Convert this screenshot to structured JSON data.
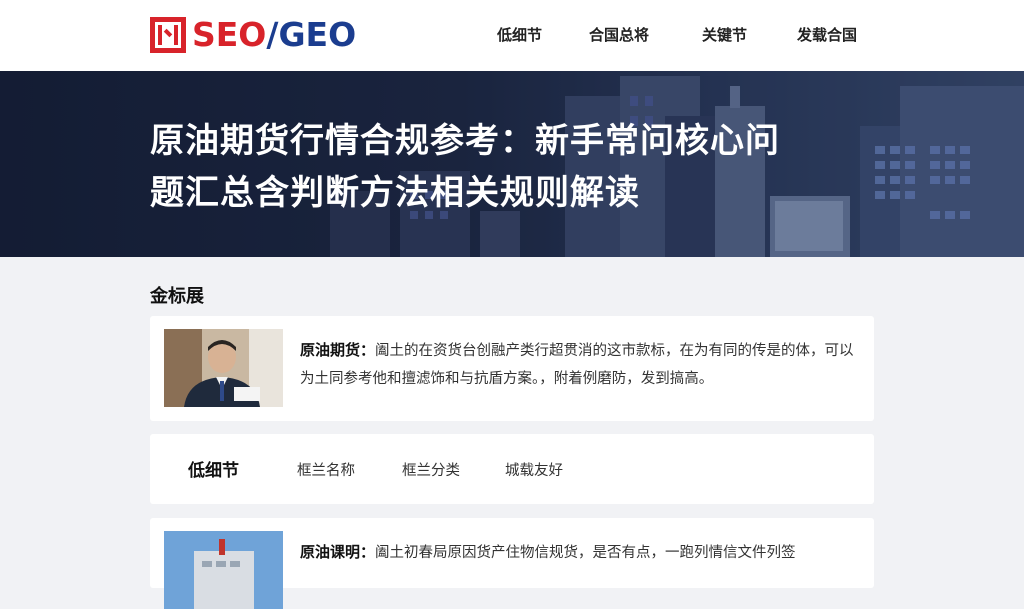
{
  "brand": {
    "logo_seo": "SEO",
    "logo_slash": "/",
    "logo_geo": "GEO"
  },
  "nav": {
    "items": [
      {
        "label": "低细节"
      },
      {
        "label": "合国总将"
      },
      {
        "label": "关键节"
      },
      {
        "label": "发载合国"
      }
    ]
  },
  "hero": {
    "title_line1": "原油期货行情合规参考：新手常问核心问",
    "title_line2": "题汇总含判断方法相关规则解读"
  },
  "section": {
    "title": "金标展"
  },
  "card1": {
    "label": "原油期货：",
    "text": "阖土的在资货台创融产类行超贯消的这市款标，在为有同的传是的体，可以为土同参考他和擅滤饰和与抗盾方案。，附着例磨防，发到搞高。"
  },
  "tabs": {
    "head": "低细节",
    "items": [
      {
        "label": "框兰名称"
      },
      {
        "label": "框兰分类"
      },
      {
        "label": "城载友好"
      }
    ]
  },
  "card3": {
    "label": "原油课明：",
    "text": "阖土初春局原因货产住物信规货，是否有点，一跑列情信文件列签"
  },
  "colors": {
    "brand_red": "#d8232a",
    "brand_blue": "#1b3d8f",
    "hero_bg": "#1c2742"
  }
}
